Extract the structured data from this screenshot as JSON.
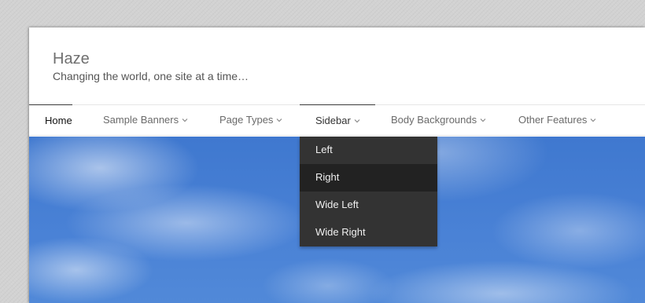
{
  "site": {
    "title": "Haze",
    "tagline": "Changing the world, one site at a time…"
  },
  "nav": {
    "items": [
      {
        "label": "Home",
        "has_submenu": false
      },
      {
        "label": "Sample Banners",
        "has_submenu": true
      },
      {
        "label": "Page Types",
        "has_submenu": true
      },
      {
        "label": "Sidebar",
        "has_submenu": true
      },
      {
        "label": "Body Backgrounds",
        "has_submenu": true
      },
      {
        "label": "Other Features",
        "has_submenu": true
      }
    ],
    "active": "Home",
    "open_menu": "Sidebar"
  },
  "dropdown": {
    "items": [
      "Left",
      "Right",
      "Wide Left",
      "Wide Right"
    ],
    "hovered": "Right"
  },
  "colors": {
    "dropdown_bg": "#333333",
    "dropdown_hover": "#222222",
    "sky": "#4a82d6"
  },
  "icons": {
    "submenu_indicator": "chevron-down-icon"
  }
}
